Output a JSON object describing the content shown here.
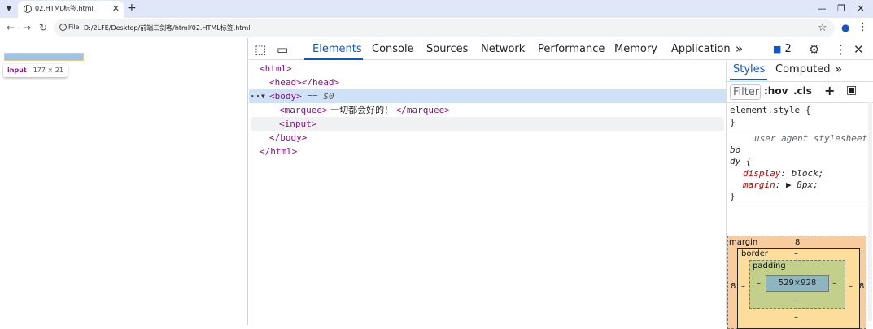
{
  "browser": {
    "tab_title": "02.HTML标签.html",
    "url_scheme_label": "File",
    "url": "D:/2LFE/Desktop/前端三剑客/html/02.HTML标签.html"
  },
  "page": {
    "tooltip_tag": "input",
    "tooltip_size": "177 × 21"
  },
  "devtools": {
    "tabs": [
      "Elements",
      "Console",
      "Sources",
      "Network",
      "Performance",
      "Memory",
      "Application"
    ],
    "more_tabs": "»",
    "issues_count": "2",
    "dom": {
      "line1": "<html>",
      "line2": "<head></head>",
      "line3_tag": "<body>",
      "line3_eq": "== $0",
      "line4_open": "<marquee>",
      "line4_text": " 一切都会好的！ ",
      "line4_close": "</marquee>",
      "line5": "<input>",
      "line6": "</body>",
      "line7": "</html>"
    },
    "styles": {
      "tabs": [
        "Styles",
        "Computed"
      ],
      "more": "»",
      "filter_placeholder": "Filter",
      "hov": ":hov",
      "cls": ".cls",
      "element_style": "element.style {",
      "close_brace": "}",
      "ua_label": "user agent stylesheet",
      "selector_1": "bo",
      "selector_2": "dy {",
      "prop_display": "display",
      "val_display": "block;",
      "prop_margin": "margin",
      "val_margin": "8px;"
    },
    "box_model": {
      "margin_label": "margin",
      "margin_top": "8",
      "margin_left": "8",
      "margin_right": "8",
      "border_label": "border",
      "border_top": "–",
      "border_left": "–",
      "border_right": "–",
      "border_bottom": "–",
      "padding_label": "padding",
      "padding_top": "–",
      "padding_left": "–",
      "padding_right": "–",
      "padding_bottom": "–",
      "content_size": "529×928"
    }
  }
}
